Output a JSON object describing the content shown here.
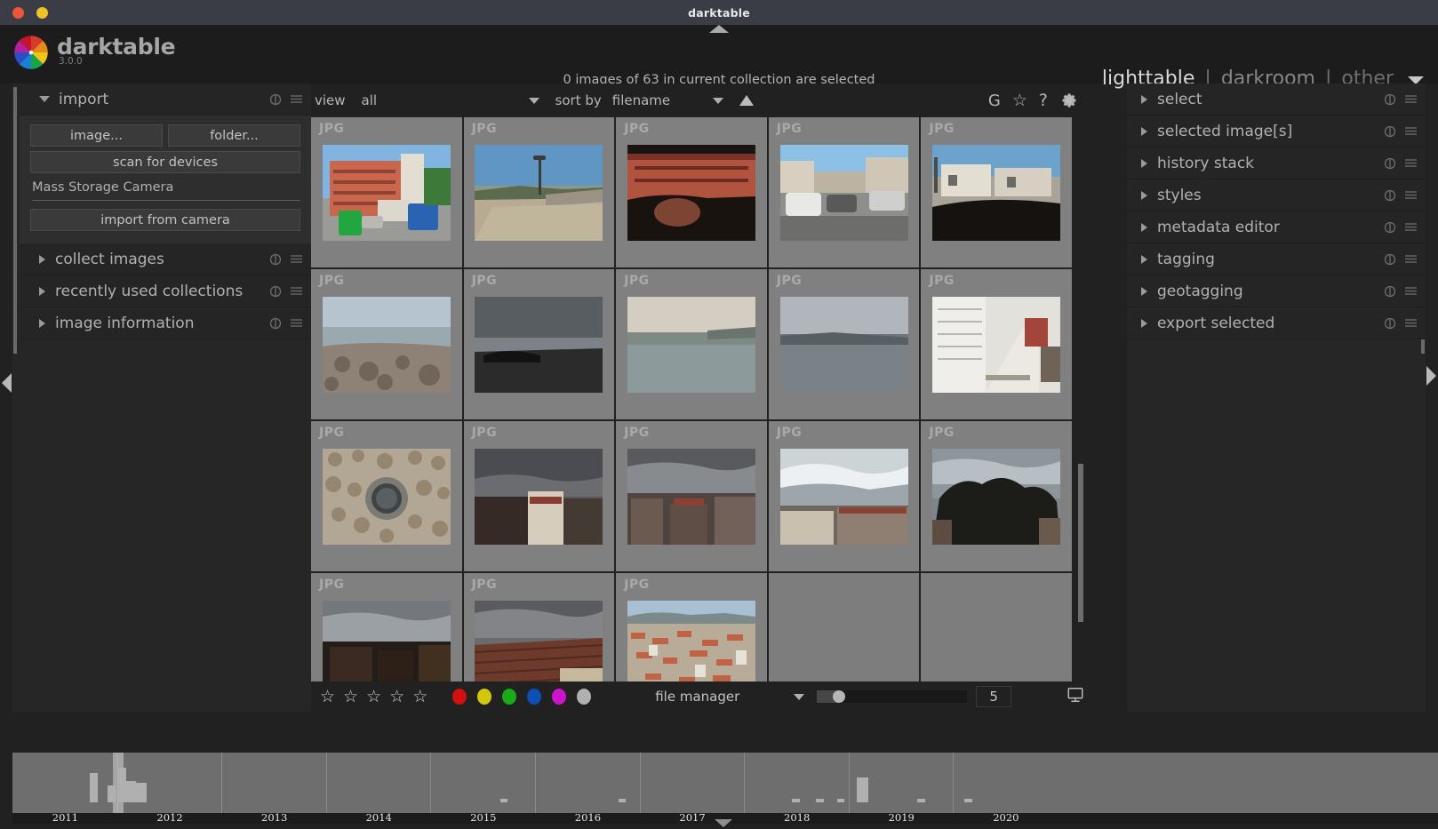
{
  "window": {
    "title": "darktable",
    "buttons": [
      {
        "name": "close",
        "color": "#e8563c"
      },
      {
        "name": "minimize",
        "color": "#f0c227"
      }
    ]
  },
  "branding": {
    "name": "darktable",
    "version": "3.0.0"
  },
  "header": {
    "collection_status": "0 images of 63 in current collection are selected",
    "views": [
      {
        "label": "lighttable",
        "active": true
      },
      {
        "label": "|",
        "sep": true
      },
      {
        "label": "darkroom",
        "active": false
      },
      {
        "label": "|",
        "sep": true
      },
      {
        "label": "other",
        "active": false,
        "dim": true
      }
    ]
  },
  "left_panel": {
    "sections": [
      {
        "label": "import",
        "expanded": true,
        "buttons": [
          {
            "label": "image...",
            "name": "import-image-button"
          },
          {
            "label": "folder...",
            "name": "import-folder-button"
          },
          {
            "label": "scan for devices",
            "name": "scan-for-devices-button"
          }
        ],
        "camera_label": "Mass Storage Camera",
        "camera_button": "import from camera"
      },
      {
        "label": "collect images",
        "expanded": false
      },
      {
        "label": "recently used collections",
        "expanded": false
      },
      {
        "label": "image information",
        "expanded": false
      }
    ]
  },
  "right_panel": {
    "sections": [
      {
        "label": "select"
      },
      {
        "label": "selected image[s]"
      },
      {
        "label": "history stack"
      },
      {
        "label": "styles"
      },
      {
        "label": "metadata editor"
      },
      {
        "label": "tagging"
      },
      {
        "label": "geotagging"
      },
      {
        "label": "export selected"
      }
    ]
  },
  "filterbar": {
    "view_label": "view",
    "view_value": "all",
    "sort_label": "sort by",
    "sort_value": "filename",
    "sort_direction": "ascending",
    "icons": [
      {
        "name": "grouping-icon",
        "glyph": "G"
      },
      {
        "name": "overlays-star-icon",
        "glyph": "☆"
      },
      {
        "name": "help-icon",
        "glyph": "?"
      },
      {
        "name": "preferences-gear-icon",
        "glyph": "gear"
      }
    ]
  },
  "grid": {
    "format_label": "JPG",
    "columns": 5,
    "thumbnails": [
      {
        "id": 1,
        "format": "JPG",
        "alt": "orange apartment block with parked cars"
      },
      {
        "id": 2,
        "format": "JPG",
        "alt": "coastal road with lamppost and shrubs"
      },
      {
        "id": 3,
        "format": "JPG",
        "alt": "red brick building seen through car window"
      },
      {
        "id": 4,
        "format": "JPG",
        "alt": "street with parked cars and white buildings"
      },
      {
        "id": 5,
        "format": "JPG",
        "alt": "white houses from car windshield"
      },
      {
        "id": 6,
        "format": "JPG",
        "alt": "rocky breakwater with overcast sky"
      },
      {
        "id": 7,
        "format": "JPG",
        "alt": "dark sea with cloudy sky"
      },
      {
        "id": 8,
        "format": "JPG",
        "alt": "pale seascape with distant hills"
      },
      {
        "id": 9,
        "format": "JPG",
        "alt": "grey sea horizon under clouds"
      },
      {
        "id": 10,
        "format": "JPG",
        "alt": "white staircase with red shutters"
      },
      {
        "id": 11,
        "format": "JPG",
        "alt": "stone wall with round porthole window"
      },
      {
        "id": 12,
        "format": "JPG",
        "alt": "rooftops under dark storm clouds"
      },
      {
        "id": 13,
        "format": "JPG",
        "alt": "town rooftops with heavy clouds"
      },
      {
        "id": 14,
        "format": "JPG",
        "alt": "bright cloudy sky over tiled roofs"
      },
      {
        "id": 15,
        "format": "JPG",
        "alt": "dark tree silhouette against clouds"
      },
      {
        "id": 16,
        "format": "JPG",
        "alt": "dim buildings at dusk"
      },
      {
        "id": 17,
        "format": "JPG",
        "alt": "terracotta roof under grey sky"
      },
      {
        "id": 18,
        "format": "JPG",
        "alt": "coastal town aerial with sea"
      }
    ]
  },
  "bottom_toolbar": {
    "stars": [
      "☆",
      "☆",
      "☆",
      "☆",
      "☆"
    ],
    "color_labels": [
      {
        "name": "red",
        "color": "#d21010"
      },
      {
        "name": "yellow",
        "color": "#d2c70d"
      },
      {
        "name": "green",
        "color": "#1aab1a"
      },
      {
        "name": "blue",
        "color": "#0d4fb4"
      },
      {
        "name": "magenta",
        "color": "#cc14cc"
      },
      {
        "name": "grey",
        "color": "#b0b0b0"
      }
    ],
    "layout_value": "file manager",
    "zoom_value": "5",
    "zoom_percent": 13,
    "focus_icon": "display-profile-icon"
  },
  "timeline": {
    "years": [
      "2011",
      "2012",
      "2013",
      "2014",
      "2015",
      "2016",
      "2017",
      "2018",
      "2019",
      "2020"
    ],
    "chart_data": {
      "type": "bar",
      "title": "",
      "xlabel": "",
      "ylabel": "",
      "categories": [
        "2011",
        "2012",
        "2013",
        "2014",
        "2015",
        "2016",
        "2017",
        "2018",
        "2019",
        "2020"
      ],
      "bars": [
        {
          "x_pct": 7.4,
          "width_pct": 0.8,
          "height_pct": 62
        },
        {
          "x_pct": 9.1,
          "width_pct": 0.8,
          "height_pct": 36
        },
        {
          "x_pct": 10.0,
          "width_pct": 0.9,
          "height_pct": 72
        },
        {
          "x_pct": 10.9,
          "width_pct": 0.9,
          "height_pct": 45
        },
        {
          "x_pct": 11.8,
          "width_pct": 1.0,
          "height_pct": 41
        },
        {
          "x_pct": 46.7,
          "width_pct": 0.7,
          "height_pct": 7
        },
        {
          "x_pct": 58.0,
          "width_pct": 0.7,
          "height_pct": 7
        },
        {
          "x_pct": 74.6,
          "width_pct": 0.7,
          "height_pct": 7
        },
        {
          "x_pct": 76.9,
          "width_pct": 0.7,
          "height_pct": 7
        },
        {
          "x_pct": 78.9,
          "width_pct": 0.7,
          "height_pct": 7
        },
        {
          "x_pct": 80.8,
          "width_pct": 1.1,
          "height_pct": 52
        },
        {
          "x_pct": 86.6,
          "width_pct": 0.7,
          "height_pct": 7
        },
        {
          "x_pct": 91.1,
          "width_pct": 0.7,
          "height_pct": 7
        }
      ],
      "highlight": {
        "x_pct": 9.6,
        "width_pct": 1.0
      }
    }
  }
}
